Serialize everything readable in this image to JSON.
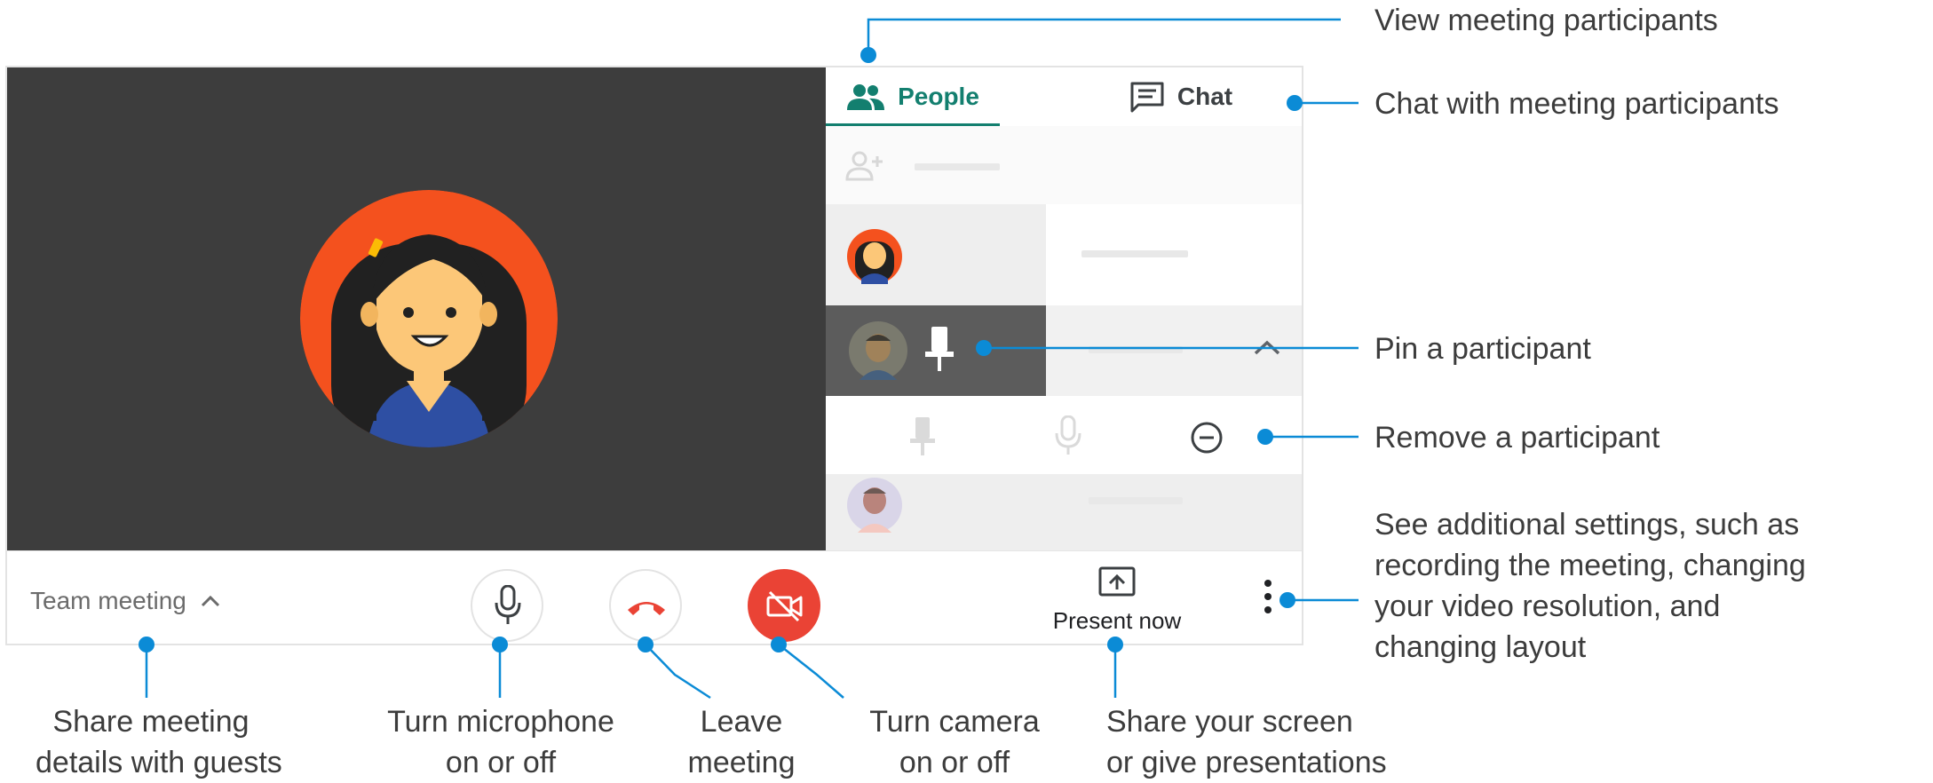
{
  "panel": {
    "tabs": [
      {
        "label": "People",
        "icon": "people-icon",
        "active": true
      },
      {
        "label": "Chat",
        "icon": "chat-icon",
        "active": false
      }
    ]
  },
  "bottom_bar": {
    "meeting_name": "Team meeting",
    "present_label": "Present now"
  },
  "annotations": {
    "view_participants": "View meeting participants",
    "chat": "Chat with meeting participants",
    "pin": "Pin a participant",
    "remove": "Remove a participant",
    "settings": [
      "See additional settings, such as",
      "recording the meeting, changing",
      "your video resolution, and",
      "changing layout"
    ],
    "share_details": [
      "Share meeting",
      "details with guests"
    ],
    "microphone": [
      "Turn microphone",
      "on or off"
    ],
    "leave": [
      "Leave",
      "meeting"
    ],
    "camera": [
      "Turn camera",
      "on or off"
    ],
    "share_screen": [
      "Share your screen",
      "or give presentations"
    ]
  },
  "colors": {
    "accent": "#137f6f",
    "callout": "#0b8bd6",
    "danger": "#ea4335",
    "stage": "#3d3d3d",
    "avatar_ring": "#f4511e"
  }
}
